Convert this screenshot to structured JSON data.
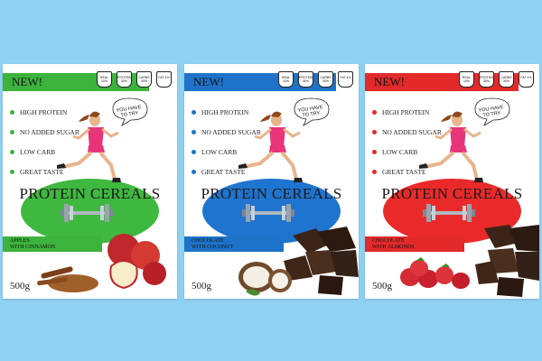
{
  "packs": [
    {
      "new_label": "NEW!",
      "badges": [
        "REAL 10%",
        "PROTEIN 30%",
        "CARBS 30%",
        "FAT 4%"
      ],
      "features": [
        "HIGH PROTEIN",
        "NO ADDED SUGAR",
        "LOW CARB",
        "GREAT TASTE"
      ],
      "bubble": "YOU HAVE TO TRY",
      "title": "PROTEIN CEREALS",
      "flavor_line1": "APPLES",
      "flavor_line2": "WITH CINNAMON",
      "weight": "500g",
      "accent": "#3cb33c",
      "ellipse": "#3fb83f"
    },
    {
      "new_label": "NEW!",
      "badges": [
        "REAL 10%",
        "PROTEIN 30%",
        "CARBS 30%",
        "FAT 4%"
      ],
      "features": [
        "HIGH PROTEIN",
        "NO ADDED SUGAR",
        "LOW CARB",
        "GREAT TASTE"
      ],
      "bubble": "YOU HAVE TO TRY",
      "title": "PROTEIN CEREALS",
      "flavor_line1": "CHOCOLATE",
      "flavor_line2": "WITH COCONUT",
      "weight": "500g",
      "accent": "#1e73c8",
      "ellipse": "#1f74cf"
    },
    {
      "new_label": "NEW!",
      "badges": [
        "REAL 10%",
        "PROTEIN 30%",
        "CARBS 30%",
        "FAT 4%"
      ],
      "features": [
        "HIGH PROTEIN",
        "NO ADDED SUGAR",
        "LOW CARB",
        "GREAT TASTE"
      ],
      "bubble": "YOU HAVE TO TRY",
      "title": "PROTEIN CEREALS",
      "flavor_line1": "CHOCOLATE",
      "flavor_line2": "WITH ALMONDS",
      "weight": "500g",
      "accent": "#e22a2a",
      "ellipse": "#ea2a2a"
    }
  ],
  "colors": {
    "background": "#8fd1f0"
  }
}
